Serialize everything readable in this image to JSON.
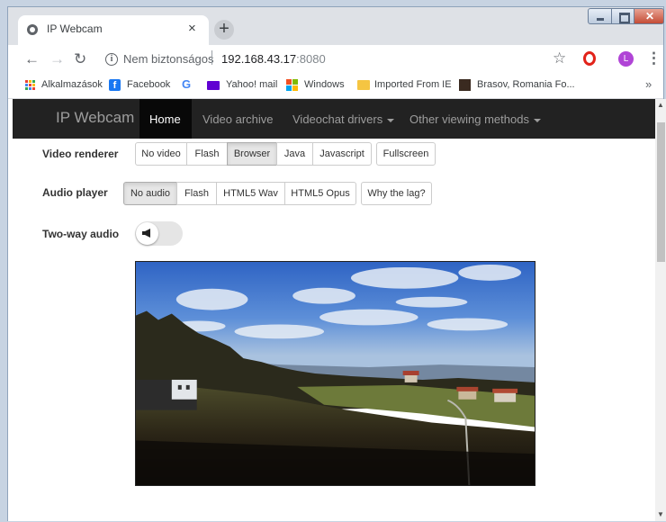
{
  "browser": {
    "tab_title": "IP Webcam",
    "tab_close": "×",
    "new_tab": "+",
    "address": {
      "security_label": "Nem biztonságos",
      "host": "192.168.43.17",
      "port": ":8080"
    },
    "profile_initial": "L",
    "bookmarks": [
      {
        "label": "Alkalmazások",
        "icon": "apps-grid-icon"
      },
      {
        "label": "Facebook",
        "icon": "facebook-icon"
      },
      {
        "label": "",
        "icon": "google-icon"
      },
      {
        "label": "Yahoo! mail",
        "icon": "yahoo-mail-icon"
      },
      {
        "label": "Windows",
        "icon": "windows-icon"
      },
      {
        "label": "Imported From IE",
        "icon": "folder-icon"
      },
      {
        "label": "Brasov, Romania Fo...",
        "icon": "brasov-icon"
      }
    ],
    "more_bookmarks": "»"
  },
  "navbar": {
    "brand": "IP Webcam",
    "items": [
      {
        "label": "Home",
        "active": true
      },
      {
        "label": "Video archive",
        "active": false
      },
      {
        "label": "Videochat drivers",
        "active": false,
        "dropdown": true
      },
      {
        "label": "Other viewing methods",
        "active": false,
        "dropdown": true
      }
    ]
  },
  "video_renderer": {
    "label": "Video renderer",
    "options": [
      "No video",
      "Flash",
      "Browser",
      "Java",
      "Javascript"
    ],
    "selected": "Browser",
    "fullscreen": "Fullscreen"
  },
  "audio_player": {
    "label": "Audio player",
    "options": [
      "No audio",
      "Flash",
      "HTML5 Wav",
      "HTML5 Opus"
    ],
    "selected": "No audio",
    "why_lag": "Why the lag?"
  },
  "two_way_audio": {
    "label": "Two-way audio",
    "enabled": false
  },
  "colors": {
    "navbar_bg": "#222222",
    "navbar_active_bg": "#080808",
    "navbar_text": "#9d9d9d",
    "button_active_bg": "#e6e6e6"
  }
}
